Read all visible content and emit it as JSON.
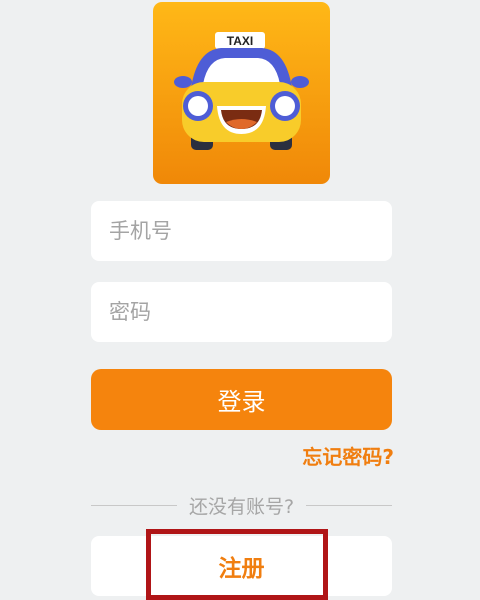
{
  "logo": {
    "sign_text": "TAXI",
    "icon": "taxi-icon",
    "colors": {
      "background_top": "#ffb416",
      "background_bottom": "#f08a08",
      "car_body": "#4e5dd6",
      "car_front": "#f8cc2a"
    }
  },
  "login_form": {
    "phone_placeholder": "手机号",
    "password_placeholder": "密码",
    "login_label": "登录",
    "forgot_label": "忘记密码?"
  },
  "divider": {
    "text": "还没有账号?"
  },
  "register": {
    "label": "注册"
  },
  "colors": {
    "accent": "#f5840d",
    "link": "#f07e10",
    "background": "#eef0f1",
    "highlight": "#b01517"
  }
}
